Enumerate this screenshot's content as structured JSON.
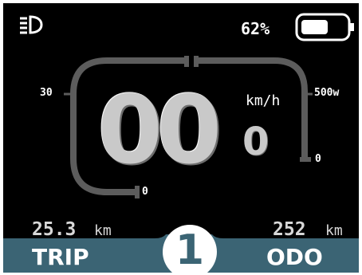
{
  "status": {
    "headlight_icon": "headlight-icon",
    "battery_percent": "62%",
    "battery_level": 0.62
  },
  "speedometer": {
    "speed_integer": "00",
    "speed_decimal": "0",
    "unit": "km/h",
    "speed_scale_max": "30",
    "speed_scale_min": "0",
    "power_scale_max": "500w",
    "power_scale_min": "0"
  },
  "trip": {
    "value": "25.3",
    "unit": "km",
    "label": "TRIP"
  },
  "odo": {
    "value": "252",
    "unit": "km",
    "label": "ODO"
  },
  "assist": {
    "level": "1"
  },
  "colors": {
    "background": "#000000",
    "bar": "#3b6474",
    "arc": "#5c5c5c",
    "text": "#ffffff"
  }
}
